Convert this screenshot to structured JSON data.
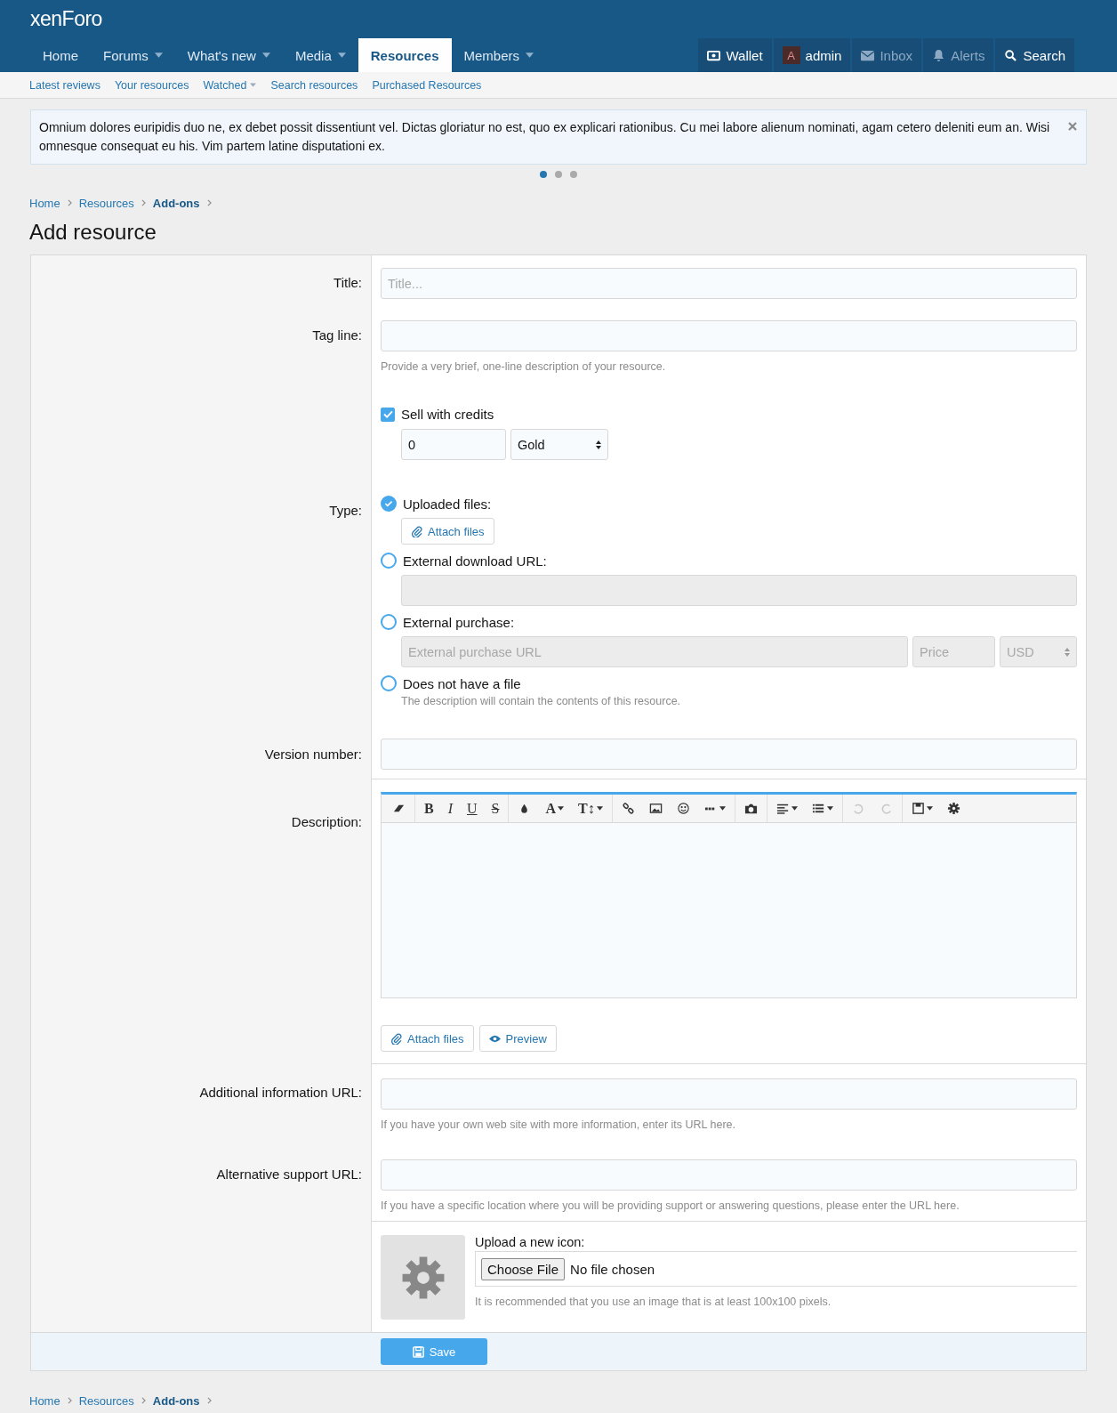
{
  "header": {
    "logo": "xenForo"
  },
  "nav": [
    {
      "label": "Home",
      "dropdown": false,
      "selected": false
    },
    {
      "label": "Forums",
      "dropdown": true,
      "selected": false
    },
    {
      "label": "What's new",
      "dropdown": true,
      "selected": false
    },
    {
      "label": "Media",
      "dropdown": true,
      "selected": false
    },
    {
      "label": "Resources",
      "dropdown": false,
      "selected": true
    },
    {
      "label": "Members",
      "dropdown": true,
      "selected": false
    }
  ],
  "user_nav": [
    {
      "kind": "wallet",
      "label": "Wallet",
      "dimmed": false
    },
    {
      "kind": "avatar",
      "avatar_letter": "A",
      "label": "admin",
      "dimmed": false
    },
    {
      "kind": "inbox",
      "label": "Inbox",
      "dimmed": true
    },
    {
      "kind": "alerts",
      "label": "Alerts",
      "dimmed": true
    },
    {
      "kind": "search",
      "label": "Search",
      "dimmed": false
    }
  ],
  "sub_nav": [
    {
      "label": "Latest reviews",
      "dropdown": false
    },
    {
      "label": "Your resources",
      "dropdown": false
    },
    {
      "label": "Watched",
      "dropdown": true
    },
    {
      "label": "Search resources",
      "dropdown": false
    },
    {
      "label": "Purchased Resources",
      "dropdown": false
    }
  ],
  "notice": {
    "text": "Omnium dolores euripidis duo ne, ex debet possit dissentiunt vel. Dictas gloriatur no est, quo ex explicari rationibus. Cu mei labore alienum nominati, agam cetero deleniti eum an. Wisi omnesque consequat eu his. Vim partem latine disputationi ex.",
    "dots": [
      {
        "selected": true
      },
      {
        "selected": false
      },
      {
        "selected": false
      }
    ]
  },
  "breadcrumb": [
    {
      "label": "Home",
      "current": false
    },
    {
      "label": "Resources",
      "current": false
    },
    {
      "label": "Add-ons",
      "current": true
    }
  ],
  "page_title": "Add resource",
  "form": {
    "title": {
      "label": "Title:",
      "placeholder": "Title..."
    },
    "tag_line": {
      "label": "Tag line:",
      "hint": "Provide a very brief, one-line description of your resource."
    },
    "sell_with_credits": {
      "label": "Sell with credits",
      "checked": true,
      "amount": "0",
      "currency": "Gold"
    },
    "type": {
      "label": "Type:",
      "options": [
        {
          "kind": "upload",
          "label": "Uploaded files:",
          "selected": true,
          "button": "Attach files"
        },
        {
          "kind": "url",
          "label": "External download URL:",
          "selected": false
        },
        {
          "kind": "purchase",
          "label": "External purchase:",
          "selected": false,
          "url_placeholder": "External purchase URL",
          "price_placeholder": "Price",
          "currency": "USD"
        },
        {
          "kind": "none",
          "label": "Does not have a file",
          "selected": false,
          "hint": "The description will contain the contents of this resource."
        }
      ]
    },
    "version": {
      "label": "Version number:"
    },
    "description": {
      "label": "Description:",
      "toolbar": [
        [
          {
            "kind": "eraser",
            "dropdown": false,
            "disabled": false
          }
        ],
        [
          {
            "kind": "bold",
            "text": "B",
            "dropdown": false,
            "disabled": false
          },
          {
            "kind": "italic",
            "text": "I",
            "dropdown": false,
            "disabled": false
          },
          {
            "kind": "underline",
            "text": "U",
            "dropdown": false,
            "disabled": false
          },
          {
            "kind": "strike",
            "text": "S",
            "dropdown": false,
            "disabled": false
          }
        ],
        [
          {
            "kind": "drop",
            "dropdown": false,
            "disabled": false
          },
          {
            "kind": "font",
            "text": "A",
            "dropdown": true,
            "disabled": false
          },
          {
            "kind": "size",
            "text": "T↕",
            "dropdown": true,
            "disabled": false
          }
        ],
        [
          {
            "kind": "link",
            "dropdown": false,
            "disabled": false
          },
          {
            "kind": "image",
            "dropdown": false,
            "disabled": false
          },
          {
            "kind": "smile",
            "dropdown": false,
            "disabled": false
          },
          {
            "kind": "more",
            "dropdown": true,
            "disabled": false
          }
        ],
        [
          {
            "kind": "camera",
            "dropdown": false,
            "disabled": false
          }
        ],
        [
          {
            "kind": "align",
            "dropdown": true,
            "disabled": false
          },
          {
            "kind": "list",
            "dropdown": true,
            "disabled": false
          }
        ],
        [
          {
            "kind": "undo",
            "dropdown": false,
            "disabled": true
          },
          {
            "kind": "redo",
            "dropdown": false,
            "disabled": true
          }
        ],
        [
          {
            "kind": "save",
            "dropdown": true,
            "disabled": false
          },
          {
            "kind": "gear",
            "dropdown": false,
            "disabled": false
          }
        ]
      ],
      "attach_button": "Attach files",
      "preview_button": "Preview"
    },
    "info_url": {
      "label": "Additional information URL:",
      "hint": "If you have your own web site with more information, enter its URL here."
    },
    "support_url": {
      "label": "Alternative support URL:",
      "hint": "If you have a specific location where you will be providing support or answering questions, please enter the URL here."
    },
    "icon": {
      "label": "Upload a new icon:",
      "choose_button": "Choose File",
      "file_status": "No file chosen",
      "hint": "It is recommended that you use an image that is at least 100x100 pixels."
    },
    "save_button": "Save"
  },
  "footer_breadcrumb": [
    {
      "label": "Home",
      "current": false
    },
    {
      "label": "Resources",
      "current": false
    },
    {
      "label": "Add-ons",
      "current": true
    }
  ]
}
